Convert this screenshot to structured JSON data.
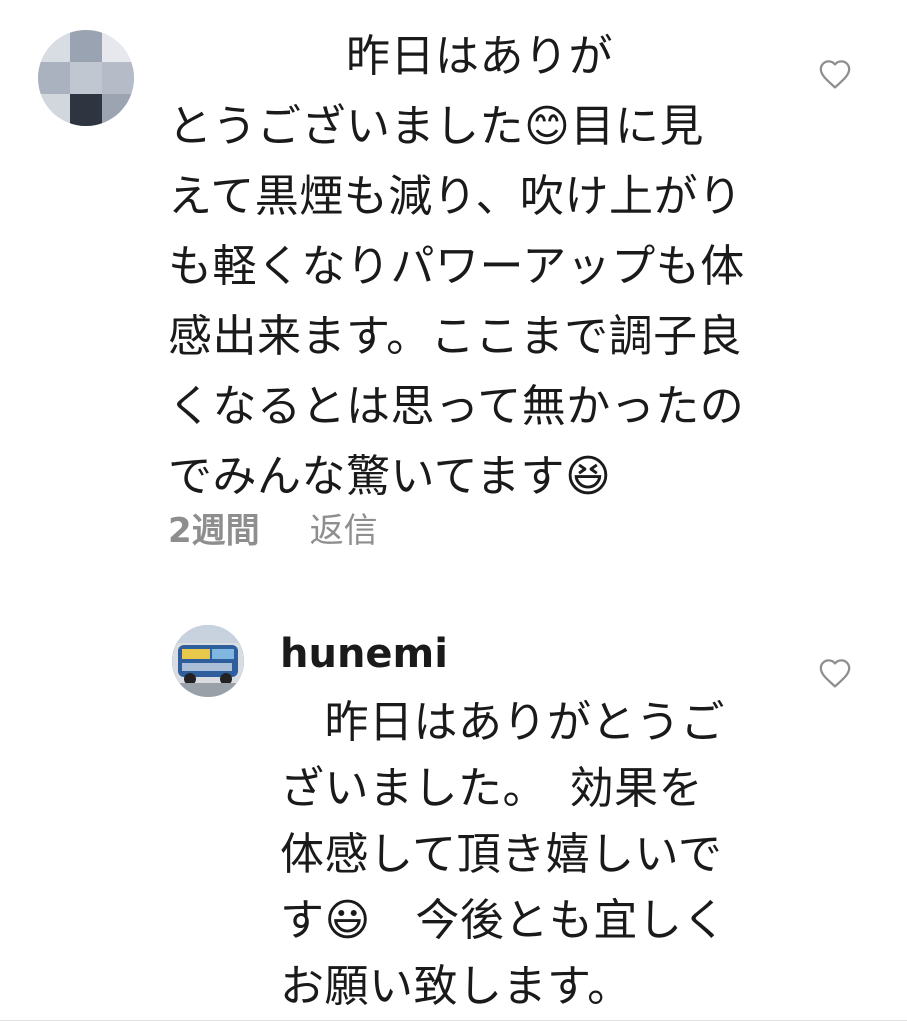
{
  "comment": {
    "text": "　　　　昨日はありが\nとうございました😊目に見\nえて黒煙も減り、吹け上がり\nも軽くなりパワーアップも体\n感出来ます。ここまで調子良\nくなるとは思って無かったの\nでみんな驚いてます😆",
    "time_label": "2週間",
    "reply_label": "返信"
  },
  "reply": {
    "username": "hunemi",
    "text": "　昨日はありがとうご\nざいました。　効果を\n体感して頂き嬉しいで\nす😃　今後とも宜しく\nお願い致します。"
  },
  "colors": {
    "text": "#1a1a1a",
    "meta": "#8e8e8e",
    "heart_outline": "#8e8e8e"
  },
  "icons": {
    "like": "heart-outline-icon"
  }
}
